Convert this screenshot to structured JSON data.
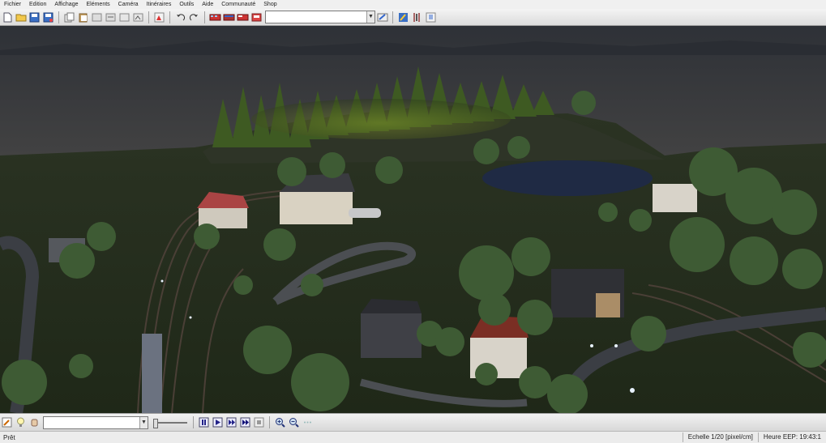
{
  "menu": [
    "Fichier",
    "Edition",
    "Affichage",
    "Eléments",
    "Caméra",
    "Itinéraires",
    "Outils",
    "Aide",
    "Communauté",
    "Shop"
  ],
  "toolbar": {
    "buttons": [
      "new-file",
      "open-folder",
      "save",
      "save-as",
      "copy",
      "paste",
      "cut",
      "select",
      "insert",
      "properties",
      "render",
      "undo",
      "redo",
      "train-red",
      "train-blue",
      "train-mixed",
      "track-signal"
    ],
    "combo_value": "",
    "right_buttons": [
      "edit-object",
      "brush",
      "tools",
      "info"
    ]
  },
  "bottombar": {
    "combo_value": "",
    "playback": [
      "pause",
      "play",
      "fast-forward",
      "fast-forward-2x",
      "stop"
    ],
    "zoom": [
      "zoom-in",
      "zoom-out"
    ]
  },
  "status": {
    "ready": "Prêt",
    "scale": "Echelle  1/20 [pixel/cm]",
    "time": "Heure EEP: 19:43:1"
  },
  "colors": {
    "sky": "#3e3f40",
    "ground": "#2a3320",
    "water": "#1f2a44"
  }
}
